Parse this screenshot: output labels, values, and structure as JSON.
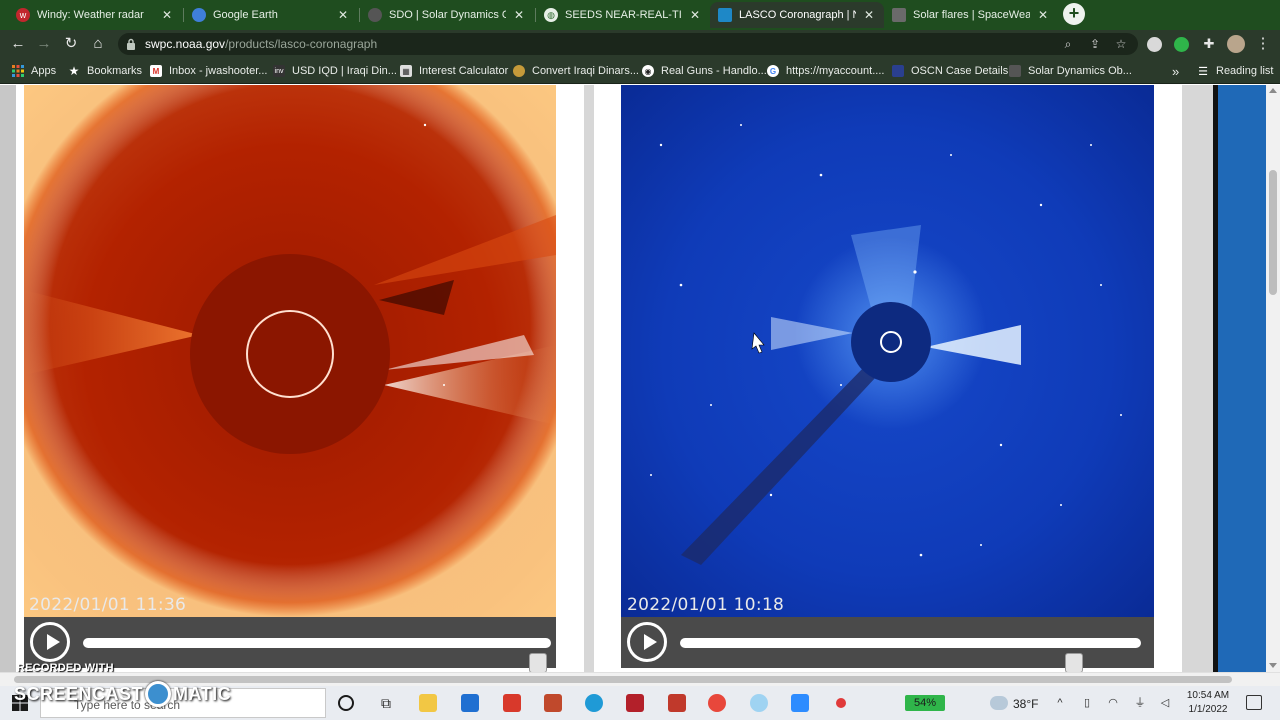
{
  "browser": {
    "tabs": [
      {
        "title": "Windy: Weather radar",
        "color": "#c1272d",
        "icon": "windy-icon",
        "active": false
      },
      {
        "title": "Google Earth",
        "color": "#3f7fd9",
        "icon": "google-earth-icon",
        "active": false
      },
      {
        "title": "SDO | Solar Dynamics Obse",
        "color": "#555555",
        "icon": "sdo-icon",
        "active": false
      },
      {
        "title": "SEEDS NEAR-REAL-TIME A",
        "color": "#2f6b2f",
        "icon": "globe-icon",
        "active": false
      },
      {
        "title": "LASCO Coronagraph | NOA",
        "color": "#1e88c7",
        "icon": "noaa-icon",
        "active": true
      },
      {
        "title": "Solar flares | SpaceWeather",
        "color": "#6a6a6a",
        "icon": "spaceweather-icon",
        "active": false
      }
    ],
    "url_host": "swpc.noaa.gov",
    "url_path": "/products/lasco-coronagraph",
    "bookmarks": [
      {
        "label": "Apps",
        "icon": "apps-grid-icon",
        "color": "#e67e22"
      },
      {
        "label": "Bookmarks",
        "icon": "star-icon",
        "color": "#2b3a2b"
      },
      {
        "label": "Inbox - jwashooter...",
        "icon": "gmail-icon",
        "color": "#d93025"
      },
      {
        "label": "USD IQD | Iraqi Din...",
        "icon": "inv-icon",
        "color": "#333333"
      },
      {
        "label": "Interest Calculator",
        "icon": "calculator-icon",
        "color": "#dddddd"
      },
      {
        "label": "Convert Iraqi Dinars...",
        "icon": "dinar-icon",
        "color": "#c59a3a"
      },
      {
        "label": "Real Guns - Handlo...",
        "icon": "guns-icon",
        "color": "#888888"
      },
      {
        "label": "https://myaccount....",
        "icon": "google-icon",
        "color": "#4285f4"
      },
      {
        "label": "OSCN Case Details",
        "icon": "oscn-icon",
        "color": "#2a3f8f"
      },
      {
        "label": "Solar Dynamics Ob...",
        "icon": "sdo-bookmark-icon",
        "color": "#555555"
      }
    ],
    "more_bookmarks": "»",
    "reading_list": "Reading list"
  },
  "page": {
    "c2": {
      "timestamp": "2022/01/01 11:36",
      "slider_position": 0.99
    },
    "c3": {
      "timestamp": "2022/01/01 10:18",
      "slider_position": 0.87
    }
  },
  "taskbar": {
    "search_placeholder": "Type here to search",
    "battery": "54%",
    "temperature": "38°F",
    "time": "10:54 AM",
    "date": "1/1/2022"
  },
  "watermark": {
    "top": "RECORDED WITH",
    "left": "SCREENCAST",
    "right": "MATIC"
  }
}
